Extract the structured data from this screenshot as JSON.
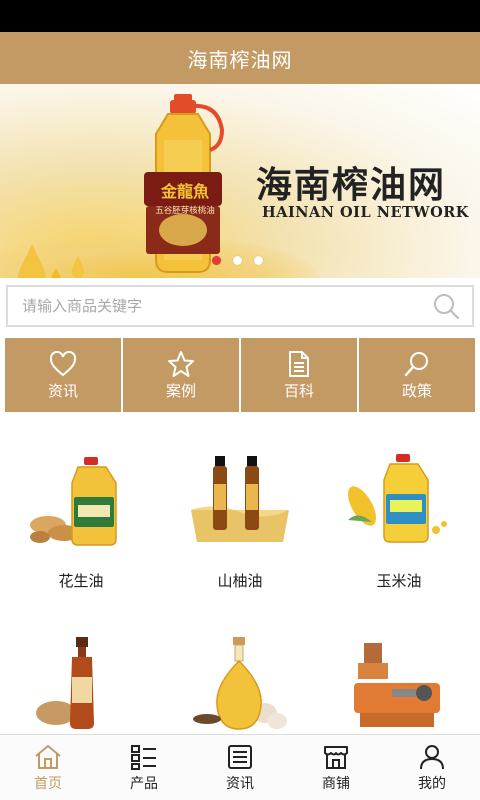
{
  "header": {
    "title": "海南榨油网"
  },
  "banner": {
    "title": "海南榨油网",
    "subtitle": "HAINAN OIL NETWORK",
    "bottle_label": "金龍魚",
    "bottle_sublabel": "五谷胚芽核桃油",
    "active_dot": 0
  },
  "search": {
    "placeholder": "请输入商品关键字",
    "value": ""
  },
  "nav": {
    "items": [
      {
        "label": "资讯",
        "icon": "heart-icon"
      },
      {
        "label": "案例",
        "icon": "star-icon"
      },
      {
        "label": "百科",
        "icon": "document-icon"
      },
      {
        "label": "政策",
        "icon": "search-icon"
      }
    ]
  },
  "products": [
    {
      "name": "花生油"
    },
    {
      "name": "山柚油"
    },
    {
      "name": "玉米油"
    },
    {
      "name": ""
    },
    {
      "name": ""
    },
    {
      "name": ""
    }
  ],
  "tabs": [
    {
      "label": "首页",
      "icon": "home-icon",
      "active": true
    },
    {
      "label": "产品",
      "icon": "list-icon",
      "active": false
    },
    {
      "label": "资讯",
      "icon": "news-icon",
      "active": false
    },
    {
      "label": "商铺",
      "icon": "store-icon",
      "active": false
    },
    {
      "label": "我的",
      "icon": "user-icon",
      "active": false
    }
  ],
  "colors": {
    "brand": "#c49a64",
    "accent_dot": "#e73b3b"
  }
}
